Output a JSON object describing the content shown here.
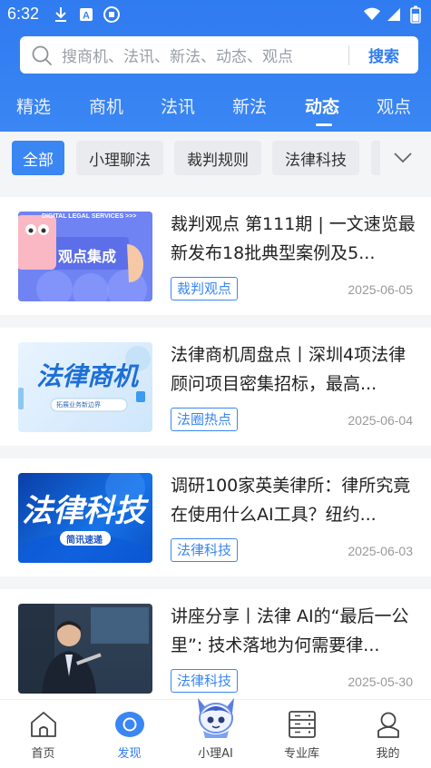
{
  "status": {
    "time": "6:32",
    "left_icons": [
      "download-icon",
      "a-box-icon",
      "shield-icon"
    ],
    "right_icons": [
      "wifi-icon",
      "signal-icon",
      "battery-icon"
    ]
  },
  "search": {
    "placeholder": "搜商机、法讯、新法、动态、观点",
    "button": "搜索"
  },
  "tabs": [
    {
      "label": "精选"
    },
    {
      "label": "商机"
    },
    {
      "label": "法讯"
    },
    {
      "label": "新法"
    },
    {
      "label": "动态",
      "active": true
    },
    {
      "label": "观点"
    }
  ],
  "filters": [
    {
      "label": "全部",
      "active": true
    },
    {
      "label": "小理聊法"
    },
    {
      "label": "裁判规则"
    },
    {
      "label": "法律科技"
    }
  ],
  "articles": [
    {
      "title": "裁判观点 第111期 | 一文速览最新发布18批典型案例及5...",
      "tag": "裁判观点",
      "date": "2025-06-05",
      "thumb_text": "观点集成",
      "thumb_banner": "DIGITAL LEGAL SERVICES >>>"
    },
    {
      "title": "法律商机周盘点丨深圳4项法律顾问项目密集招标，最高...",
      "tag": "法圈热点",
      "date": "2025-06-04",
      "thumb_text": "法律商机",
      "thumb_sub": "拓展业务新边界"
    },
    {
      "title": "调研100家英美律所：律所究竟在使用什么AI工具？纽约...",
      "tag": "法律科技",
      "date": "2025-06-03",
      "thumb_text": "法律科技",
      "thumb_sub": "简讯速递"
    },
    {
      "title": "讲座分享丨法律 AI的“最后一公里”: 技术落地为何需要律...",
      "tag": "法律科技",
      "date": "2025-05-30"
    }
  ],
  "bottom_nav": [
    {
      "label": "首页",
      "icon": "home-icon"
    },
    {
      "label": "发现",
      "icon": "discover-icon",
      "active": true
    },
    {
      "label": "小理AI",
      "icon": "ai-mascot-icon"
    },
    {
      "label": "专业库",
      "icon": "library-icon"
    },
    {
      "label": "我的",
      "icon": "profile-icon"
    }
  ],
  "colors": {
    "brand_blue": "#2f7bf0",
    "tag_blue": "#3a86f3",
    "background": "#f4f5f7"
  }
}
